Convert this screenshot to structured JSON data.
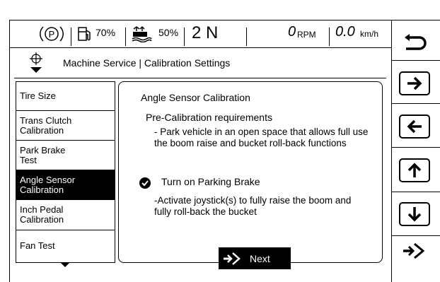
{
  "status_bar": {
    "gear_indicator": "P",
    "fuel_percent": "70%",
    "def_percent": "50%",
    "gear": "2 N",
    "rpm_value": "0",
    "rpm_unit": "RPM",
    "speed_value": "0.0",
    "speed_unit": "km/h"
  },
  "header": {
    "breadcrumb": "Machine Service | Calibration Settings"
  },
  "sidebar": {
    "items": [
      {
        "label": "Tire Size"
      },
      {
        "label": "Trans Clutch Calibration"
      },
      {
        "label": "Park Brake Test"
      },
      {
        "label": "Angle Sensor Calibration",
        "active": true
      },
      {
        "label": "Inch Pedal Calibration"
      },
      {
        "label": "Fan Test"
      }
    ]
  },
  "content": {
    "title": "Angle Sensor Calibration",
    "requirements_heading": "Pre-Calibration requirements",
    "requirement_text": "- Park vehicle in an open space that allows full use the boom raise and bucket roll-back functions",
    "check_item": "Turn on Parking Brake",
    "instruction": "-Activate joystick(s) to fully raise the boom and fully roll-back the bucket",
    "next_button": "Next"
  },
  "nav_buttons": [
    "back-icon",
    "arrow-right-icon",
    "arrow-left-icon",
    "arrow-up-icon",
    "arrow-down-icon",
    "enter-icon"
  ],
  "colors": {
    "active_bg": "#000000",
    "active_fg": "#ffffff",
    "border": "#000000"
  }
}
